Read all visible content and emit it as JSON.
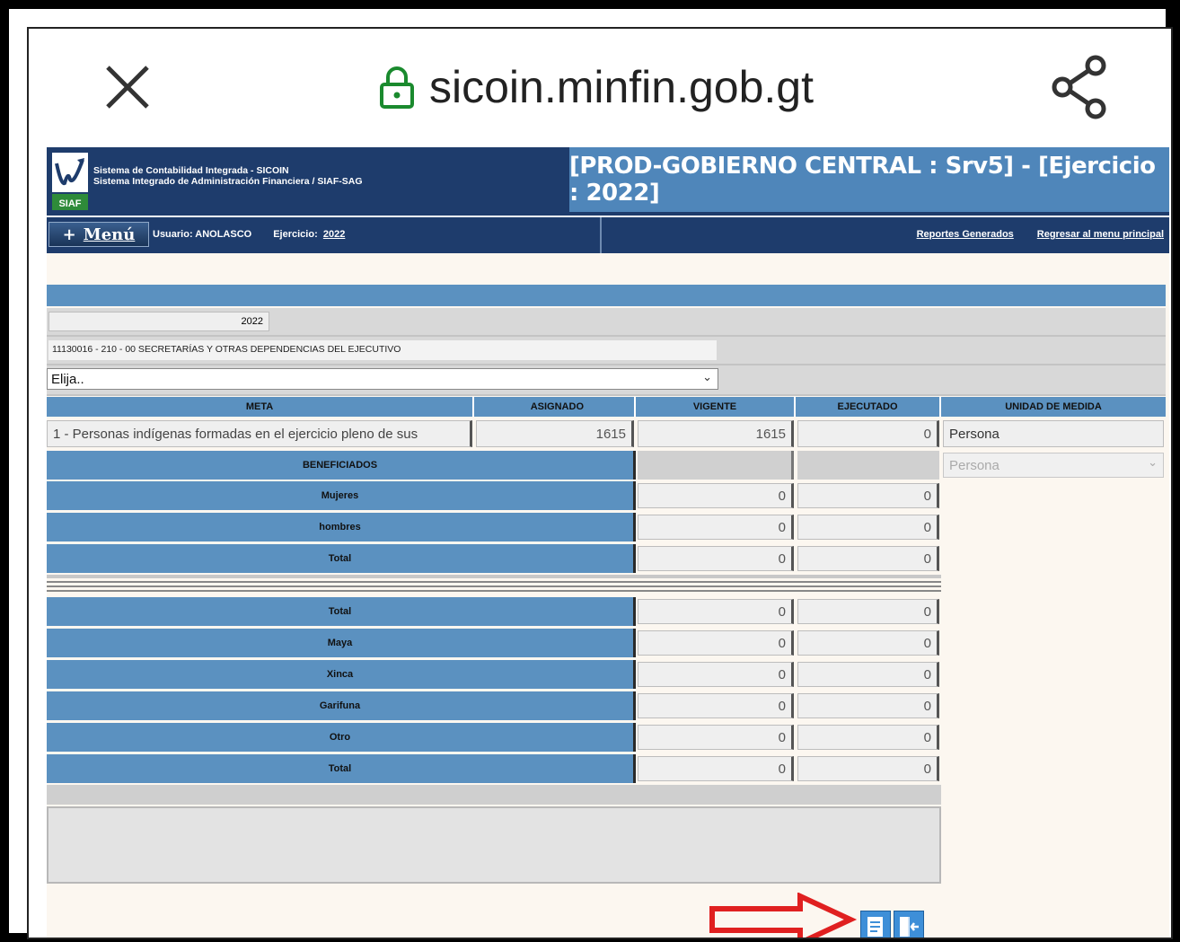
{
  "browser": {
    "url": "sicoin.minfin.gob.gt"
  },
  "header": {
    "logo_text": "SIAF",
    "system_line1": "Sistema de Contabilidad Integrada - SICOIN",
    "system_line2": "Sistema Integrado de Administración Financiera / SIAF-SAG",
    "environment": "[PROD-GOBIERNO CENTRAL : Srv5] - [Ejercicio : 2022]"
  },
  "nav": {
    "menu_plus": "+",
    "menu_label": "Menú",
    "user_label": "Usuario: ANOLASCO",
    "exercise_label": "Ejercicio:",
    "exercise_value": "2022",
    "link_reports": "Reportes Generados",
    "link_back": "Regresar al menu principal"
  },
  "form": {
    "year": "2022",
    "entity": "11130016 - 210 - 00 SECRETARÍAS Y OTRAS DEPENDENCIAS DEL EJECUTIVO",
    "select_value": "Elija..",
    "columns": [
      "META",
      "ASIGNADO",
      "VIGENTE",
      "EJECUTADO",
      "UNIDAD DE MEDIDA"
    ],
    "meta_row": {
      "meta": "1 - Personas indígenas formadas en el ejercicio pleno de sus",
      "asignado": "1615",
      "vigente": "1615",
      "ejecutado": "0",
      "unidad": "Persona",
      "unidad_select": "Persona"
    },
    "beneficiados_header": "BENEFICIADOS",
    "rows_gender": [
      {
        "label": "Mujeres",
        "vigente": "0",
        "ejecutado": "0"
      },
      {
        "label": "hombres",
        "vigente": "0",
        "ejecutado": "0"
      },
      {
        "label": "Total",
        "vigente": "0",
        "ejecutado": "0"
      }
    ],
    "rows_people": [
      {
        "label": "Total",
        "vigente": "0",
        "ejecutado": "0"
      },
      {
        "label": "Maya",
        "vigente": "0",
        "ejecutado": "0"
      },
      {
        "label": "Xinca",
        "vigente": "0",
        "ejecutado": "0"
      },
      {
        "label": "Garifuna",
        "vigente": "0",
        "ejecutado": "0"
      },
      {
        "label": "Otro",
        "vigente": "0",
        "ejecutado": "0"
      },
      {
        "label": "Total",
        "vigente": "0",
        "ejecutado": "0"
      }
    ]
  },
  "colors": {
    "header_blue": "#1e3c6c",
    "table_blue": "#5b91c0",
    "arrow_red": "#e02020"
  }
}
